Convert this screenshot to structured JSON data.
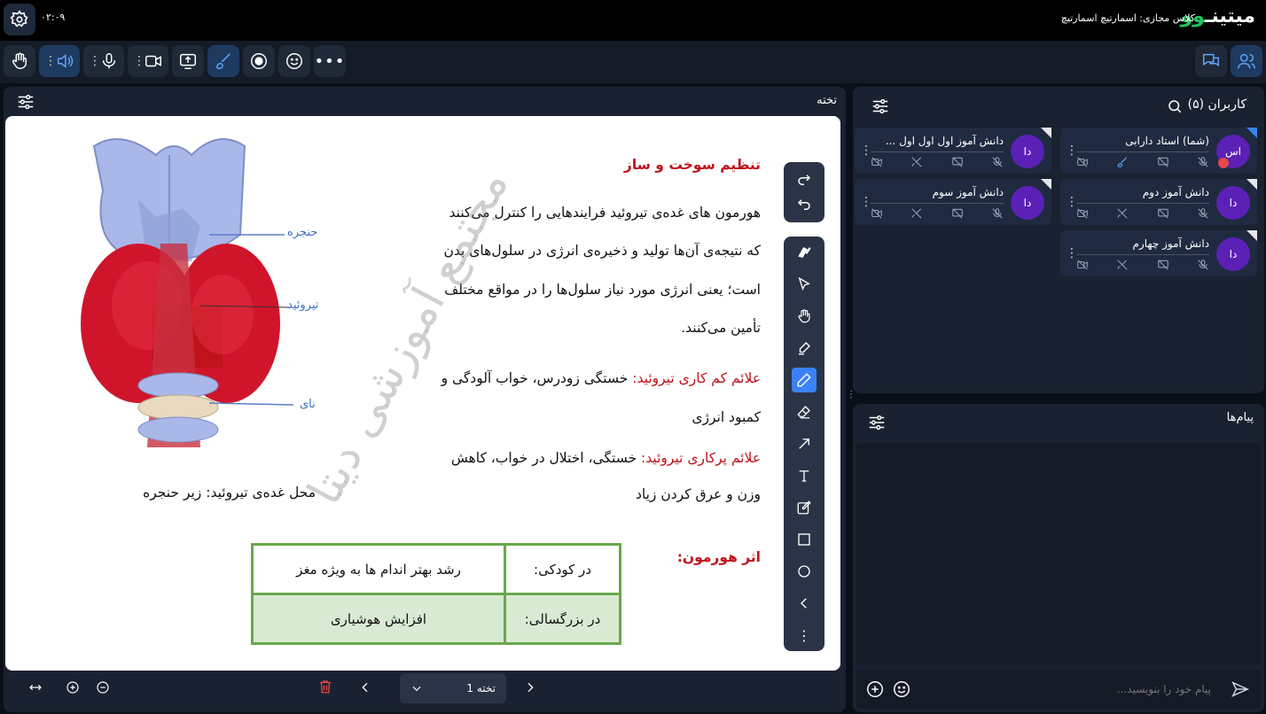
{
  "app": {
    "logo_main": "میتینـ",
    "logo_accent": "وو",
    "class_title": "کلاس مجازی: اسمارتیچ اسمارتیچ",
    "clock": "۰۲:۰۹"
  },
  "whiteboard": {
    "title": "تخته",
    "heading": "تنظیم سوخت و ساز",
    "para1": [
      "هورمون های غده‌ی تیروئید فرایندهایی را کنترل می‌کنند",
      "که نتیجه‌ی آن‌ها تولید و ذخیره‌ی انرژی در سلول‌های بدن",
      "است؛ یعنی انرژی مورد نیاز سلول‌ها را در مواقع مختلف",
      "تأمین می‌کنند."
    ],
    "hypo_label": "علائم کم کاری تیروئید:",
    "hypo_text": "خستگی زودرس، خواب آلودگی و",
    "hypo_text2": "کمبود انرژی",
    "hyper_label": "علائم پرکاری تیروئید:",
    "hyper_text": "خستگی، اختلال در خواب، کاهش",
    "hyper_text2": "وزن و عرق کردن زیاد",
    "location": "محل غده‌ی تیروئید: زیر حنجره",
    "effect_label": "اثر هورمون:",
    "table": [
      {
        "label": "در کودکی:",
        "value": "رشد بهتر اندام ها به ویژه مغز"
      },
      {
        "label": "در بزرگسالی:",
        "value": "افزایش هوشیاری"
      }
    ],
    "diagram_labels": {
      "larynx": "حنجره",
      "thyroid": "تیروئید",
      "trachea": "نای"
    },
    "watermark": "مجتمع آموزشی دیتا",
    "page_label": "تخته 1"
  },
  "users": {
    "title": "کاربران (۵)",
    "list": [
      {
        "avatar": "اس",
        "name": "(شما) استاد دارابی"
      },
      {
        "avatar": "دا",
        "name": "دانش آموز اول اول اول ..."
      },
      {
        "avatar": "دا",
        "name": "دانش آموز دوم"
      },
      {
        "avatar": "دا",
        "name": "دانش آموز سوم"
      },
      {
        "avatar": "دا",
        "name": "دانش آموز چهارم"
      }
    ]
  },
  "chat": {
    "title": "پیام‌ها",
    "placeholder": "پیام خود را بنویسید..."
  },
  "colors": {
    "accent": "#3b82f6",
    "title_red": "#c0121b",
    "table_border": "#6aa84f",
    "table_fill": "#d9ead3",
    "avatar": "#5b21b6",
    "logo_green": "#22c55e"
  }
}
